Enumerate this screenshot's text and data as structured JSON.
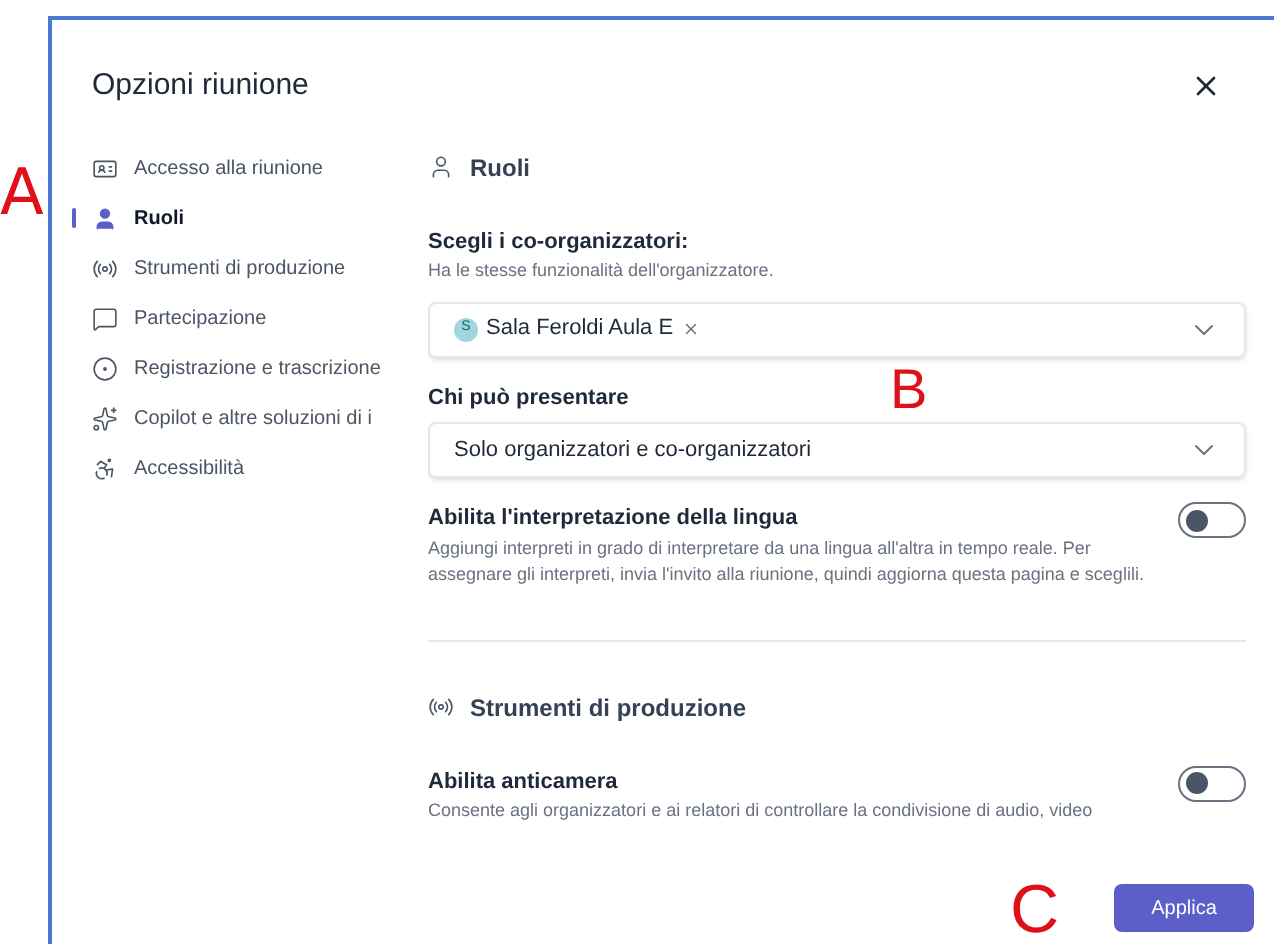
{
  "dialog": {
    "title": "Opzioni riunione"
  },
  "sidebar": {
    "items": [
      {
        "label": "Accesso alla riunione",
        "kind": "card",
        "selected": false
      },
      {
        "label": "Ruoli",
        "kind": "person",
        "selected": true
      },
      {
        "label": "Strumenti di produzione",
        "kind": "broadcast",
        "selected": false
      },
      {
        "label": "Partecipazione",
        "kind": "chat",
        "selected": false
      },
      {
        "label": "Registrazione e trascrizione",
        "kind": "record",
        "selected": false
      },
      {
        "label": "Copilot e altre soluzioni di i",
        "kind": "copilot",
        "selected": false
      },
      {
        "label": "Accessibilità",
        "kind": "accessibility",
        "selected": false
      }
    ]
  },
  "sections": [
    {
      "heading": "Ruoli",
      "kind": "person",
      "settings": [
        {
          "kind": "people_picker",
          "label": "Scegli i co-organizzatori:",
          "description": "Ha le stesse funzionalità dell'organizzatore.",
          "chips": [
            {
              "initial": "S",
              "name": "Sala Feroldi Aula E"
            }
          ]
        },
        {
          "kind": "dropdown",
          "label": "Chi può presentare",
          "value": "Solo organizzatori e co-organizzatori"
        },
        {
          "kind": "toggle",
          "label": "Abilita l'interpretazione della lingua",
          "description": "Aggiungi interpreti in grado di interpretare da una lingua all'altra in tempo reale. Per assegnare gli interpreti, invia l'invito alla riunione, quindi aggiorna questa pagina e sceglili.",
          "on": false
        }
      ]
    },
    {
      "heading": "Strumenti di produzione",
      "kind": "broadcast",
      "settings": [
        {
          "kind": "toggle",
          "label": "Abilita anticamera",
          "description": "Consente agli organizzatori e ai relatori di controllare la condivisione di audio, video",
          "on": false
        }
      ]
    }
  ],
  "footer": {
    "apply_button": "Applica"
  },
  "annotations": [
    "A",
    "B",
    "C"
  ]
}
